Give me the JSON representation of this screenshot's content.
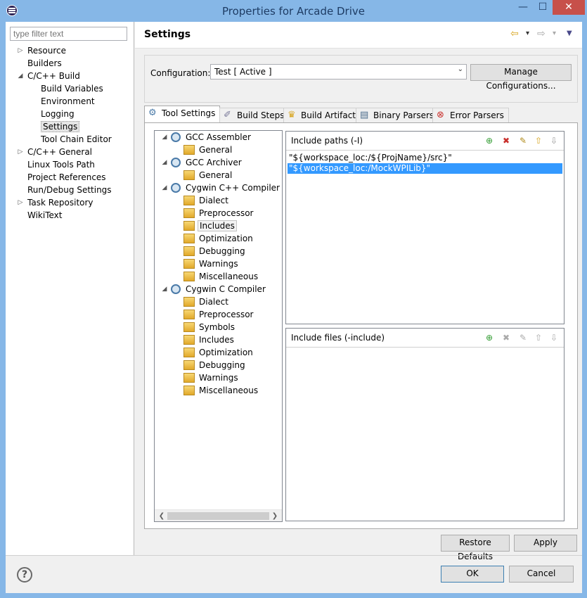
{
  "window": {
    "title": "Properties for Arcade Drive",
    "minimize": "—",
    "maximize": "☐",
    "close": "✕"
  },
  "filter": {
    "placeholder": "type filter text"
  },
  "nav": {
    "items": [
      {
        "label": "Resource",
        "level": 0,
        "expander": "▷"
      },
      {
        "label": "Builders",
        "level": 0,
        "expander": ""
      },
      {
        "label": "C/C++ Build",
        "level": 0,
        "expander": "◢"
      },
      {
        "label": "Build Variables",
        "level": 1,
        "expander": ""
      },
      {
        "label": "Environment",
        "level": 1,
        "expander": ""
      },
      {
        "label": "Logging",
        "level": 1,
        "expander": ""
      },
      {
        "label": "Settings",
        "level": 1,
        "expander": "",
        "selected": true
      },
      {
        "label": "Tool Chain Editor",
        "level": 1,
        "expander": ""
      },
      {
        "label": "C/C++ General",
        "level": 0,
        "expander": "▷"
      },
      {
        "label": "Linux Tools Path",
        "level": 0,
        "expander": ""
      },
      {
        "label": "Project References",
        "level": 0,
        "expander": ""
      },
      {
        "label": "Run/Debug Settings",
        "level": 0,
        "expander": ""
      },
      {
        "label": "Task Repository",
        "level": 0,
        "expander": "▷"
      },
      {
        "label": "WikiText",
        "level": 0,
        "expander": ""
      }
    ]
  },
  "header": {
    "title": "Settings",
    "back": "⇦",
    "forward": "⇨",
    "dropdown": "▾",
    "menu": "▼"
  },
  "configuration": {
    "label": "Configuration:",
    "value": "Test  [ Active ]",
    "manage_label": "Manage Configurations..."
  },
  "tabs": [
    {
      "label": "Tool Settings",
      "icon": "tool-settings-icon",
      "active": true
    },
    {
      "label": "Build Steps",
      "icon": "build-steps-icon"
    },
    {
      "label": "Build Artifact",
      "icon": "build-artifact-icon"
    },
    {
      "label": "Binary Parsers",
      "icon": "binary-parsers-icon"
    },
    {
      "label": "Error Parsers",
      "icon": "error-parsers-icon"
    }
  ],
  "tooltree": [
    {
      "label": "GCC Assembler",
      "type": "tool"
    },
    {
      "label": "General",
      "type": "option"
    },
    {
      "label": "GCC Archiver",
      "type": "tool"
    },
    {
      "label": "General",
      "type": "option"
    },
    {
      "label": "Cygwin C++ Compiler",
      "type": "tool"
    },
    {
      "label": "Dialect",
      "type": "option"
    },
    {
      "label": "Preprocessor",
      "type": "option"
    },
    {
      "label": "Includes",
      "type": "option",
      "selected": true
    },
    {
      "label": "Optimization",
      "type": "option"
    },
    {
      "label": "Debugging",
      "type": "option"
    },
    {
      "label": "Warnings",
      "type": "option"
    },
    {
      "label": "Miscellaneous",
      "type": "option"
    },
    {
      "label": "Cygwin C Compiler",
      "type": "tool"
    },
    {
      "label": "Dialect",
      "type": "option"
    },
    {
      "label": "Preprocessor",
      "type": "option"
    },
    {
      "label": "Symbols",
      "type": "option"
    },
    {
      "label": "Includes",
      "type": "option"
    },
    {
      "label": "Optimization",
      "type": "option"
    },
    {
      "label": "Debugging",
      "type": "option"
    },
    {
      "label": "Warnings",
      "type": "option"
    },
    {
      "label": "Miscellaneous",
      "type": "option"
    }
  ],
  "include_paths": {
    "label": "Include paths (-I)",
    "rows": [
      {
        "value": "\"${workspace_loc:/${ProjName}/src}\""
      },
      {
        "value": "\"${workspace_loc:/MockWPILib}\"",
        "selected": true
      }
    ]
  },
  "include_files": {
    "label": "Include files (-include)",
    "rows": []
  },
  "buttons": {
    "restore_defaults": "Restore Defaults",
    "apply": "Apply",
    "ok": "OK",
    "cancel": "Cancel",
    "help": "?"
  },
  "colors": {
    "title_bar": "#86b7e7",
    "selection": "#3399ff",
    "close_button": "#c7504a"
  }
}
